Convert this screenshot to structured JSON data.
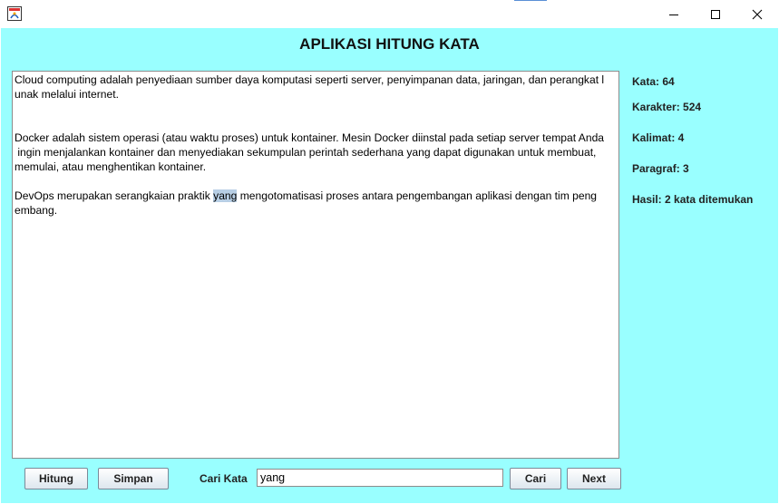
{
  "window": {
    "title": "",
    "icons": {
      "app": "java-app-icon",
      "minimize": "minimize-icon",
      "maximize": "maximize-icon",
      "close": "close-icon"
    }
  },
  "app": {
    "title": "APLIKASI HITUNG KATA"
  },
  "editor": {
    "lines_p1": [
      "Cloud computing adalah penyediaan sumber daya komputasi seperti server, penyimpanan data, jaringan, dan perangkat l",
      "unak melalui internet."
    ],
    "lines_p2": [
      "Docker adalah sistem operasi (atau waktu proses) untuk kontainer. Mesin Docker diinstal pada setiap server tempat Anda",
      " ingin menjalankan kontainer dan menyediakan sekumpulan perintah sederhana yang dapat digunakan untuk membuat,",
      "memulai, atau menghentikan kontainer."
    ],
    "p3_line1_before": "DevOps merupakan serangkaian praktik ",
    "p3_line1_highlight": "yang",
    "p3_line1_after": " mengotomatisasi proses antara pengembangan aplikasi dengan tim peng",
    "p3_line2": "embang."
  },
  "stats": {
    "kata": "Kata: 64",
    "karakter": "Karakter: 524",
    "kalimat": "Kalimat: 4",
    "paragraf": "Paragraf: 3",
    "hasil": "Hasil: 2 kata ditemukan"
  },
  "controls": {
    "hitung_label": "Hitung",
    "simpan_label": "Simpan",
    "cari_kata_label": "Cari Kata",
    "search_value": "yang",
    "cari_label": "Cari",
    "next_label": "Next"
  },
  "colors": {
    "background": "#99ffff",
    "highlight": "#b8cfe5"
  }
}
